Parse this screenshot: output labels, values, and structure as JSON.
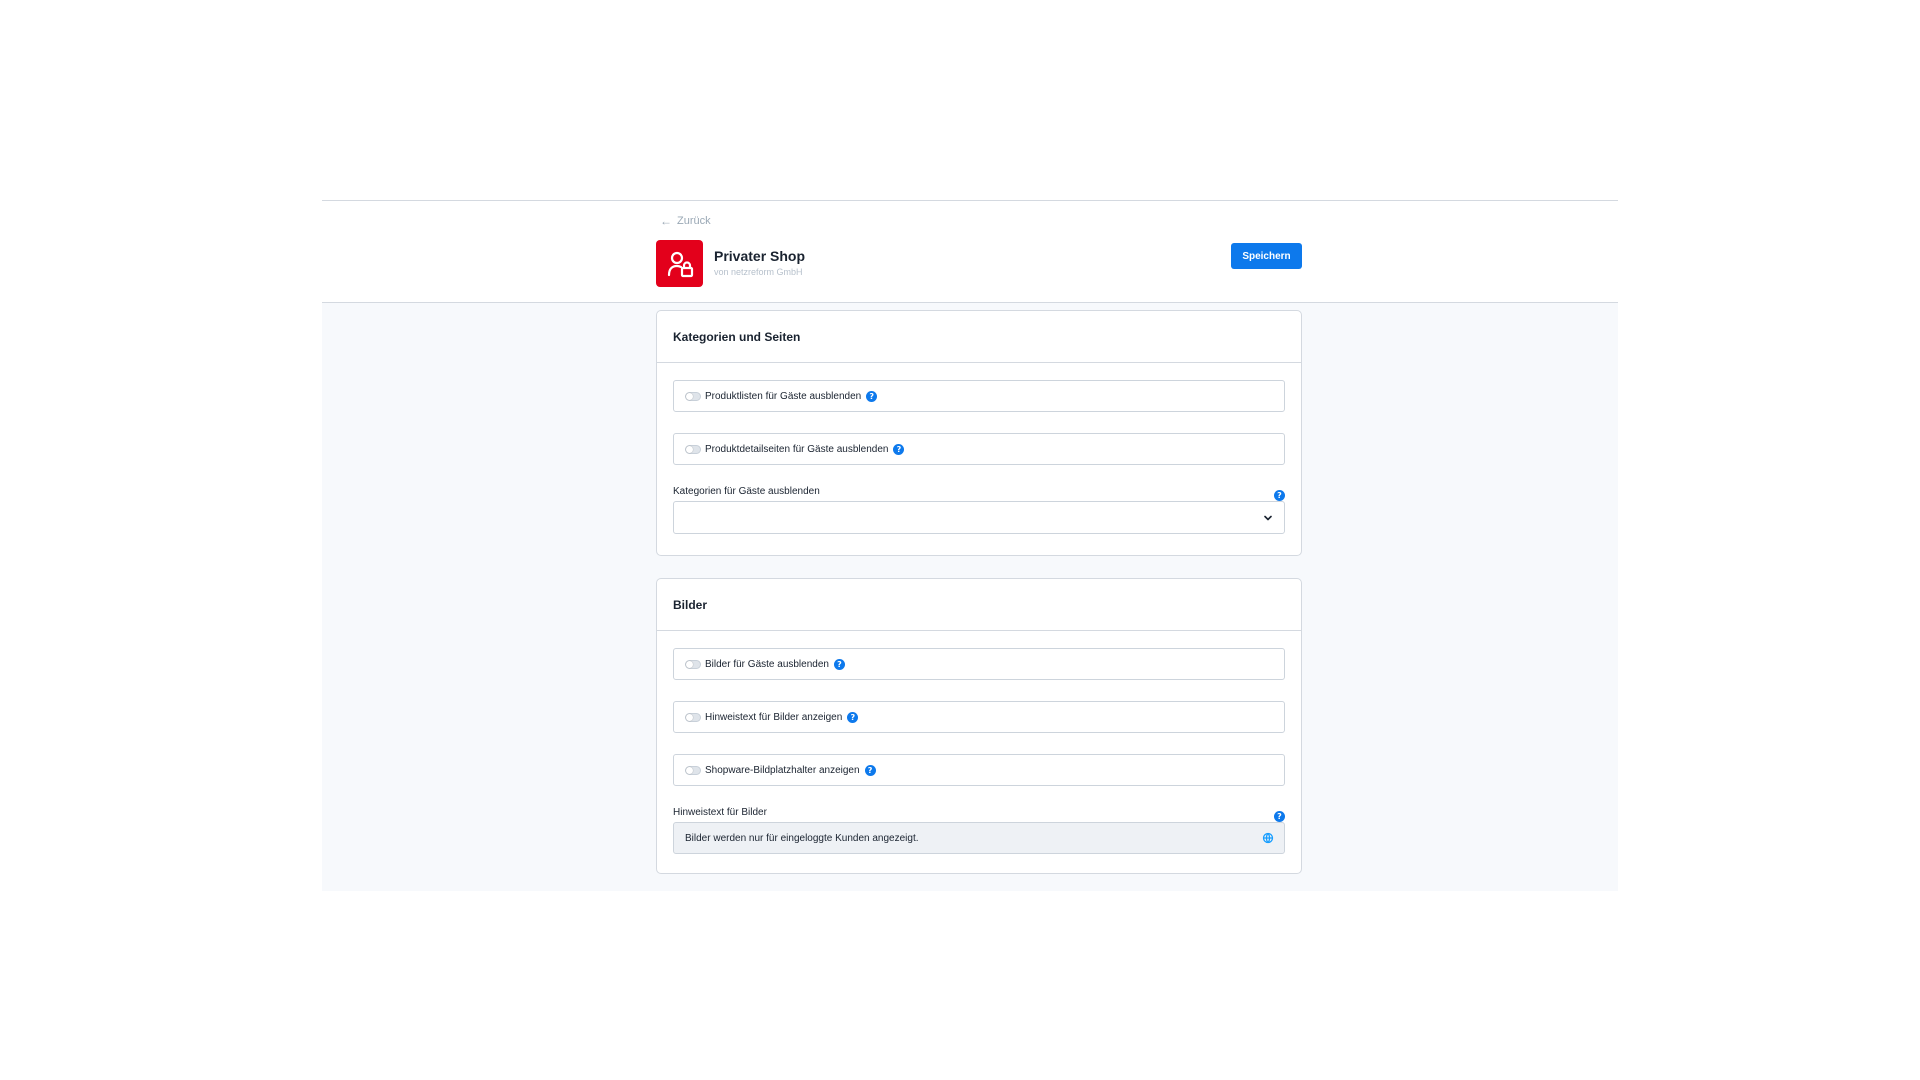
{
  "header": {
    "back_label": "Zurück",
    "app_title": "Privater Shop",
    "app_vendor": "von netzreform GmbH",
    "save_label": "Speichern"
  },
  "colors": {
    "brand_icon_bg": "#e3001b",
    "primary": "#0d79ec",
    "content_bg": "#f7f9fc"
  },
  "cards": {
    "categories": {
      "title": "Kategorien und Seiten",
      "toggles": [
        {
          "label": "Produktlisten für Gäste ausblenden",
          "enabled": false
        },
        {
          "label": "Produktdetailseiten für Gäste ausblenden",
          "enabled": false
        }
      ],
      "select": {
        "label": "Kategorien für Gäste ausblenden",
        "value": ""
      }
    },
    "images": {
      "title": "Bilder",
      "toggles": [
        {
          "label": "Bilder für Gäste ausblenden",
          "enabled": false
        },
        {
          "label": "Hinweistext für Bilder anzeigen",
          "enabled": false
        },
        {
          "label": "Shopware-Bildplatzhalter anzeigen",
          "enabled": false
        }
      ],
      "text_field": {
        "label": "Hinweistext für Bilder",
        "value": "Bilder werden nur für eingeloggte Kunden angezeigt."
      }
    }
  },
  "icons": {
    "back": "arrow-left-icon",
    "app": "user-lock-icon",
    "info": "info-icon",
    "select": "chevron-down-icon",
    "translate": "globe-icon"
  }
}
